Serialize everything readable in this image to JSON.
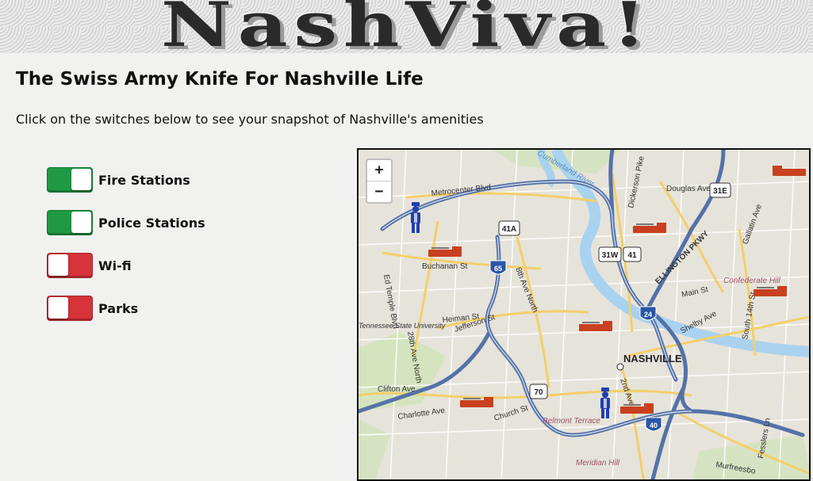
{
  "header": {
    "logo_text": "NashViva!"
  },
  "page": {
    "title": "The Swiss Army Knife For Nashville Life",
    "subtitle": "Click on the switches below to see your snapshot of Nashville's amenities"
  },
  "toggles": [
    {
      "label": "Fire Stations",
      "state": "on"
    },
    {
      "label": "Police Stations",
      "state": "on"
    },
    {
      "label": "Wi-fi",
      "state": "off"
    },
    {
      "label": "Parks",
      "state": "off"
    }
  ],
  "colors": {
    "on": "#1f9a43",
    "off": "#d6333a",
    "fire_marker": "#c8401f",
    "police_marker": "#1f3fb0"
  },
  "map": {
    "zoom_in": "+",
    "zoom_out": "−",
    "city_label": "NASHVILLE",
    "street_labels": {
      "metrocenter": "Metrocenter Blvd",
      "douglas": "Douglas Ave",
      "dickerson": "Dickerson Pike",
      "buchanan": "Buchanan St",
      "eighth_ave": "8th Ave North",
      "ed_temple": "Ed Temple Blvd",
      "heiman": "Heiman St",
      "jefferson": "Jefferson St",
      "ellington": "ELLINGTON PKWY",
      "main": "Main St",
      "shelby": "Shelby Ave",
      "charlotte": "Charlotte Ave",
      "church": "Church St",
      "clifton": "Clifton Ave",
      "second_ave": "2nd Ave S",
      "fessler": "Fesslers Ln",
      "fourteenth": "South 14th St",
      "gallatin": "Gallatin Ave",
      "murfreesboro": "Murfreesbo",
      "river": "Cumberland River",
      "tsu": "Tennessee State University",
      "twentyeighth": "28th Ave North",
      "confederate": "Confederate Hill",
      "belmont": "Belmont Terrace",
      "meridian": "Meridian Hill"
    },
    "shields": [
      "41A",
      "31E",
      "31W",
      "41",
      "65",
      "24",
      "70",
      "40"
    ]
  }
}
